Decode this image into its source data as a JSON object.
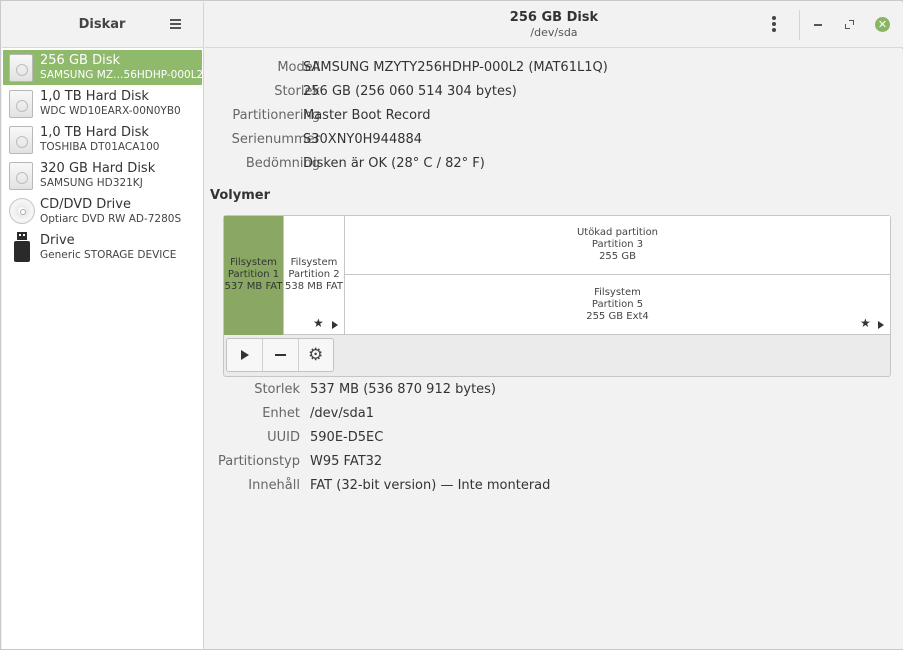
{
  "sidebar": {
    "title": "Diskar",
    "items": [
      {
        "label": "256 GB Disk",
        "sublabel": "SAMSUNG MZ…56HDHP-000L2",
        "icon": "hard-disk-icon",
        "selected": true
      },
      {
        "label": "1,0 TB Hard Disk",
        "sublabel": "WDC WD10EARX-00N0YB0",
        "icon": "hard-disk-icon"
      },
      {
        "label": "1,0 TB Hard Disk",
        "sublabel": "TOSHIBA DT01ACA100",
        "icon": "hard-disk-icon"
      },
      {
        "label": "320 GB Hard Disk",
        "sublabel": "SAMSUNG HD321KJ",
        "icon": "hard-disk-icon"
      },
      {
        "label": "CD/DVD Drive",
        "sublabel": "Optiarc DVD RW AD-7280S",
        "icon": "optical-disc-icon"
      },
      {
        "label": "Drive",
        "sublabel": "Generic STORAGE DEVICE",
        "icon": "usb-drive-icon"
      }
    ]
  },
  "header": {
    "title": "256 GB Disk",
    "subtitle": "/dev/sda",
    "close_glyph": "✕"
  },
  "disk": {
    "model_label": "Modell",
    "model": "SAMSUNG MZYTY256HDHP-000L2 (MAT61L1Q)",
    "size_label": "Storlek",
    "size": "256 GB (256 060 514 304 bytes)",
    "partitioning_label": "Partitionering",
    "partitioning": "Master Boot Record",
    "serial_label": "Serienummer",
    "serial": "S30XNY0H944884",
    "assessment_label": "Bedömning",
    "assessment": "Disken är OK (28° C / 82° F)"
  },
  "volumes": {
    "heading": "Volymer",
    "partitions": [
      {
        "line1": "Filsystem",
        "line2": "Partition 1",
        "line3": "537 MB FAT",
        "selected": true
      },
      {
        "line1": "Filsystem",
        "line2": "Partition 2",
        "line3": "538 MB FAT"
      },
      {
        "line1": "Utökad partition",
        "line2": "Partition 3",
        "line3": "255 GB"
      },
      {
        "line1": "Filsystem",
        "line2": "Partition 5",
        "line3": "255 GB Ext4"
      }
    ],
    "star_glyph": "★"
  },
  "toolbar": {
    "gear_glyph": "⚙"
  },
  "selected_volume": {
    "size_label": "Storlek",
    "size": "537 MB (536 870 912 bytes)",
    "device_label": "Enhet",
    "device": "/dev/sda1",
    "uuid_label": "UUID",
    "uuid": "590E-D5EC",
    "type_label": "Partitionstyp",
    "type": "W95 FAT32",
    "contents_label": "Innehåll",
    "contents": "FAT (32-bit version) — Inte monterad"
  },
  "colors": {
    "accent": "#8fb96b",
    "partition_selected": "#8aa864",
    "close_button": "#8ab563"
  }
}
